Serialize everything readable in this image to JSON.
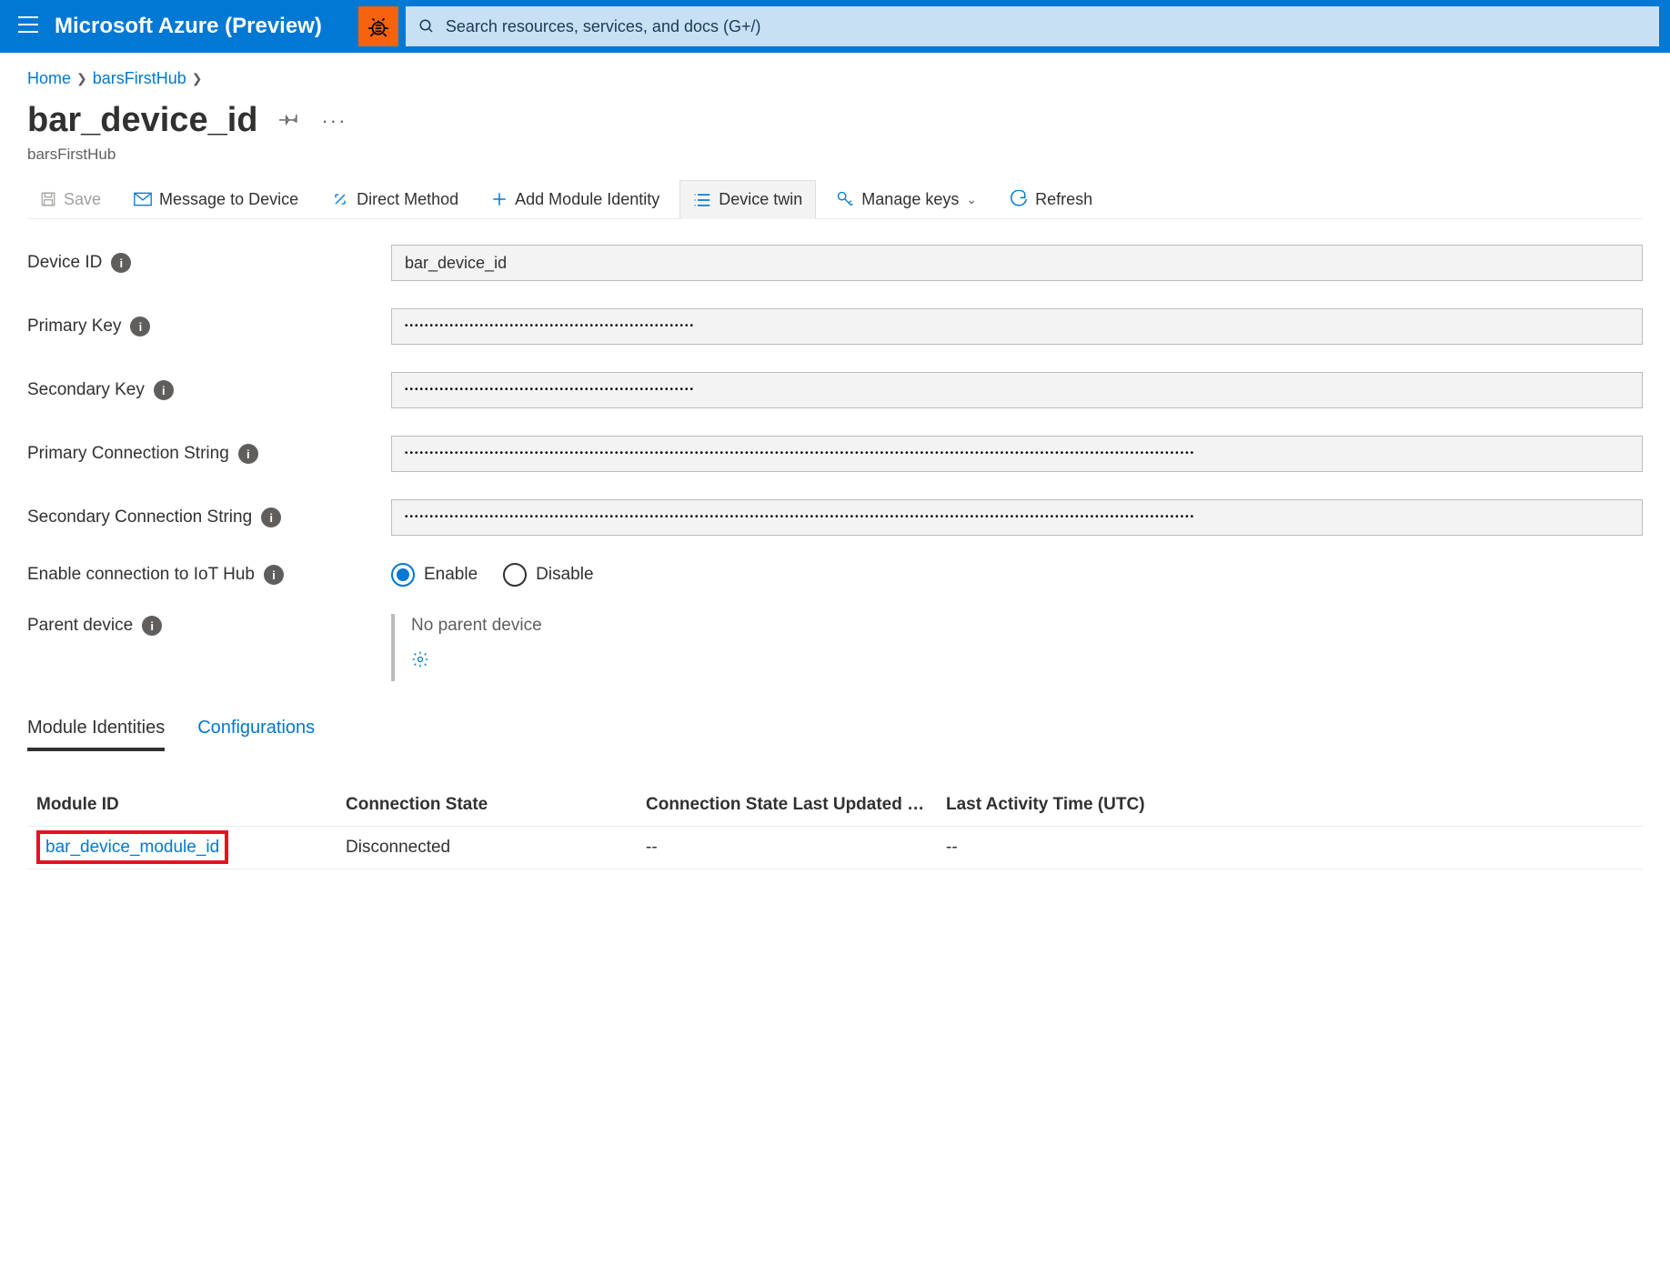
{
  "header": {
    "brand": "Microsoft Azure (Preview)",
    "search_placeholder": "Search resources, services, and docs (G+/)"
  },
  "breadcrumb": {
    "home": "Home",
    "hub": "barsFirstHub"
  },
  "page": {
    "title": "bar_device_id",
    "subtitle": "barsFirstHub"
  },
  "toolbar": {
    "save": "Save",
    "message": "Message to Device",
    "direct_method": "Direct Method",
    "add_module": "Add Module Identity",
    "device_twin": "Device twin",
    "manage_keys": "Manage keys",
    "refresh": "Refresh"
  },
  "fields": {
    "device_id": {
      "label": "Device ID",
      "value": "bar_device_id"
    },
    "primary_key": {
      "label": "Primary Key",
      "value": "••••••••••••••••••••••••••••••••••••••••••••••••••••••••••"
    },
    "secondary_key": {
      "label": "Secondary Key",
      "value": "••••••••••••••••••••••••••••••••••••••••••••••••••••••••••"
    },
    "primary_conn": {
      "label": "Primary Connection String",
      "value": "••••••••••••••••••••••••••••••••••••••••••••••••••••••••••••••••••••••••••••••••••••••••••••••••••••••••••••••••••••••••••••••••••••••••••••••••••••••••••••••"
    },
    "secondary_conn": {
      "label": "Secondary Connection String",
      "value": "••••••••••••••••••••••••••••••••••••••••••••••••••••••••••••••••••••••••••••••••••••••••••••••••••••••••••••••••••••••••••••••••••••••••••••••••••••••••••••••"
    },
    "enable_conn": {
      "label": "Enable connection to IoT Hub",
      "enable": "Enable",
      "disable": "Disable"
    },
    "parent": {
      "label": "Parent device",
      "value": "No parent device"
    }
  },
  "tabs": {
    "module_identities": "Module Identities",
    "configurations": "Configurations"
  },
  "table": {
    "headers": {
      "module_id": "Module ID",
      "conn_state": "Connection State",
      "conn_updated": "Connection State Last Updated …",
      "last_activity": "Last Activity Time (UTC)"
    },
    "row": {
      "module_id": "bar_device_module_id",
      "conn_state": "Disconnected",
      "conn_updated": "--",
      "last_activity": "--"
    }
  }
}
